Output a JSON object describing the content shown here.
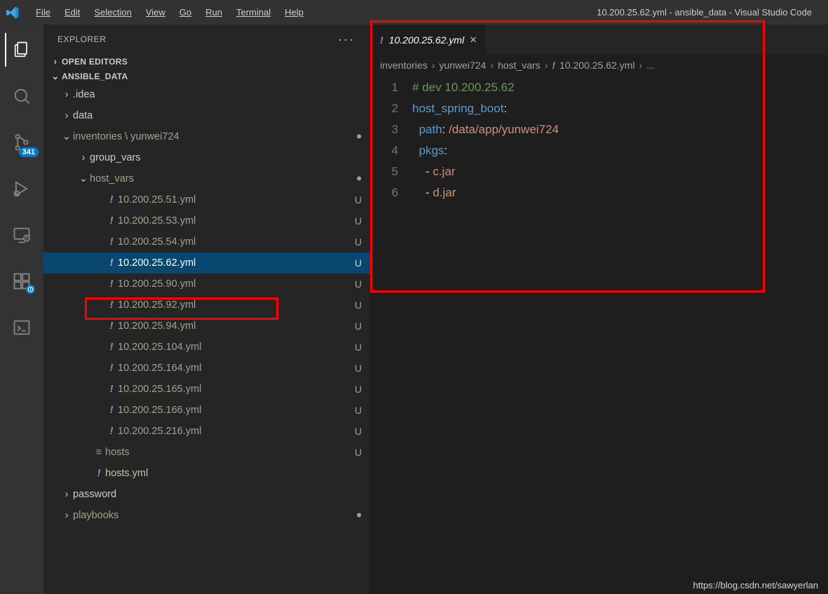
{
  "title": "10.200.25.62.yml - ansible_data - Visual Studio Code",
  "menu": [
    "File",
    "Edit",
    "Selection",
    "View",
    "Go",
    "Run",
    "Terminal",
    "Help"
  ],
  "activity": {
    "scm_badge": "341"
  },
  "sidebar": {
    "title": "EXPLORER",
    "openEditors": "OPEN EDITORS",
    "root": "ANSIBLE_DATA",
    "folders": {
      "idea": ".idea",
      "data": "data",
      "inventories": "inventories \\ yunwei724",
      "group_vars": "group_vars",
      "host_vars": "host_vars",
      "password": "password",
      "playbooks": "playbooks"
    },
    "hostvarFiles": [
      "10.200.25.51.yml",
      "10.200.25.53.yml",
      "10.200.25.54.yml",
      "10.200.25.62.yml",
      "10.200.25.90.yml",
      "10.200.25.92.yml",
      "10.200.25.94.yml",
      "10.200.25.104.yml",
      "10.200.25.164.yml",
      "10.200.25.165.yml",
      "10.200.25.166.yml",
      "10.200.25.216.yml"
    ],
    "hosts_text": "hosts",
    "hosts_yml": "hosts.yml",
    "status_u": "U"
  },
  "tab": {
    "label": "10.200.25.62.yml"
  },
  "breadcrumb": [
    "inventories",
    "yunwei724",
    "host_vars",
    "10.200.25.62.yml",
    "..."
  ],
  "code": {
    "lines": [
      "1",
      "2",
      "3",
      "4",
      "5",
      "6"
    ],
    "l1_comment": "# dev 10.200.25.62",
    "l2_key": "host_spring_boot",
    "l3_key": "path",
    "l3_val": "/data/app/yunwei724",
    "l4_key": "pkgs",
    "l5_val": "c.jar",
    "l6_val": "d.jar"
  },
  "footer": "https://blog.csdn.net/sawyerlan"
}
